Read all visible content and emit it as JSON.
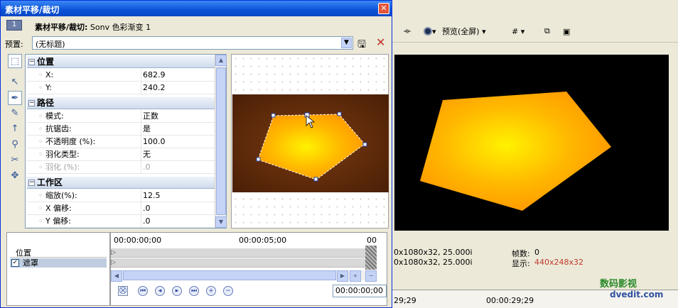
{
  "window": {
    "title": "素材平移/裁切",
    "close_glyph": "✕"
  },
  "header": {
    "index": "1",
    "label": "素材平移/裁切:",
    "media": "Sonv 色彩渐变 1"
  },
  "preset": {
    "label": "预置:",
    "value": "(无标题)"
  },
  "sections": [
    {
      "title": "位置",
      "rows": [
        {
          "key": "X:",
          "value": "682.9"
        },
        {
          "key": "Y:",
          "value": "240.2"
        }
      ]
    },
    {
      "title": "路径",
      "rows": [
        {
          "key": "模式:",
          "value": "正数"
        },
        {
          "key": "抗锯齿:",
          "value": "是"
        },
        {
          "key": "不透明度 (%):",
          "value": "100.0"
        },
        {
          "key": "羽化类型:",
          "value": "无"
        },
        {
          "key": "羽化 (%):",
          "value": ".0",
          "disabled": true
        }
      ]
    },
    {
      "title": "工作区",
      "rows": [
        {
          "key": "缩放(%):",
          "value": "12.5"
        },
        {
          "key": "X 偏移:",
          "value": ".0"
        },
        {
          "key": "Y 偏移:",
          "value": ".0"
        }
      ]
    }
  ],
  "keyframes": {
    "labels": [
      "位置",
      "遮罩"
    ],
    "mask_checked": true,
    "ruler": [
      "00:00:00;00",
      "00:00:05;00",
      "00"
    ],
    "timecode": "00:00:00;00"
  },
  "main_toolbar": {
    "preview_label": "预览(全屏)"
  },
  "status": {
    "left1": "0x1080x32, 25.000i",
    "left2": "0x1080x32, 25.000i",
    "frames_label": "帧数:",
    "frames_value": "0",
    "display_label": "显示:",
    "display_value": "440x248x32"
  },
  "timeline": {
    "t1": "29;29",
    "t2": "00:00:29;29"
  },
  "watermark": {
    "line1": "数码影视",
    "line2": "dvedit.com"
  },
  "colors": {
    "accent": "#0a52d6",
    "shape_fill": "#ffb800",
    "display_value": "#c0392b"
  }
}
